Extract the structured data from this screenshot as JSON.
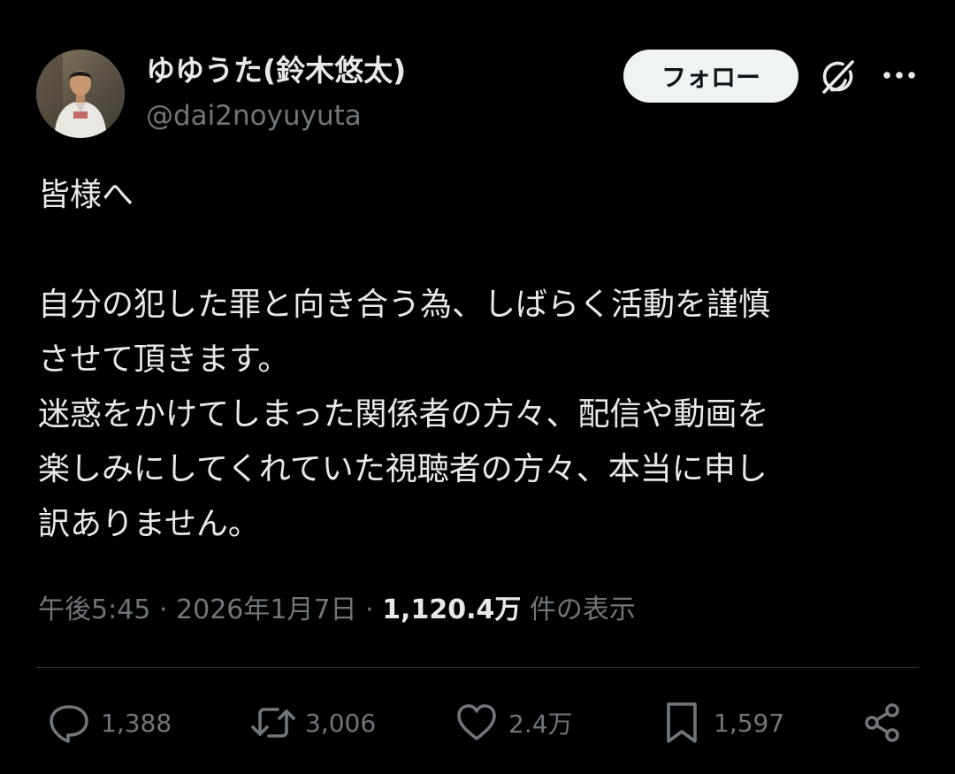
{
  "user": {
    "display_name": "ゆゆうた(鈴木悠太)",
    "handle": "@dai2noyuyuta"
  },
  "header": {
    "follow_label": "フォロー",
    "grok_icon": "grok-icon",
    "more_icon": "more-icon"
  },
  "tweet": {
    "lines": [
      "皆様へ",
      "",
      "自分の犯した罪と向き合う為、しばらく活動を謹慎",
      "させて頂きます。",
      "迷惑をかけてしまった関係者の方々、配信や動画を",
      "楽しみにしてくれていた視聴者の方々、本当に申し",
      "訳ありません。"
    ]
  },
  "meta": {
    "time": "午後5:45",
    "separator": "·",
    "date": "2026年1月7日",
    "views_count": "1,120.4万",
    "views_label": "件の表示"
  },
  "actions": {
    "reply": {
      "icon": "reply-icon",
      "count": "1,388"
    },
    "repost": {
      "icon": "repost-icon",
      "count": "3,006"
    },
    "like": {
      "icon": "heart-icon",
      "count": "2.4万"
    },
    "bookmark": {
      "icon": "bookmark-icon",
      "count": "1,597"
    },
    "share": {
      "icon": "share-icon"
    }
  },
  "colors": {
    "background": "#000000",
    "text_primary": "#e7e9ea",
    "text_secondary": "#71767b",
    "divider": "#2f3336",
    "follow_bg": "#eff3f4"
  }
}
